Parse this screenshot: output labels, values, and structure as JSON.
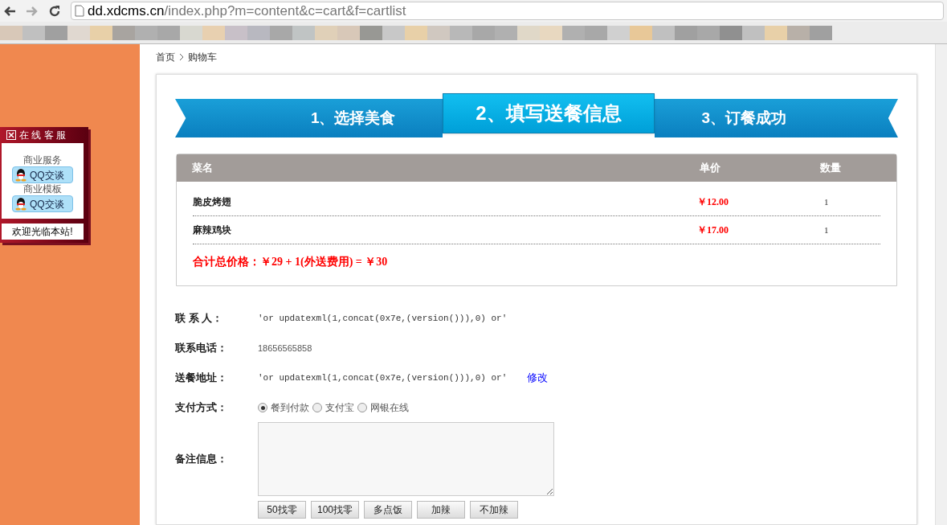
{
  "browser": {
    "url_host": "dd.xdcms.cn",
    "url_path": "/index.php?m=content&c=cart&f=cartlist"
  },
  "service_panel": {
    "title": "在 线 客 服",
    "groups": [
      {
        "label": "商业服务",
        "button": "QQ交谈"
      },
      {
        "label": "商业模板",
        "button": "QQ交谈"
      }
    ],
    "footer": "欢迎光临本站!"
  },
  "breadcrumb": [
    "首页",
    "购物车"
  ],
  "steps": [
    {
      "label": "1、选择美食",
      "selected": false
    },
    {
      "label": "2、填写送餐信息",
      "selected": true
    },
    {
      "label": "3、订餐成功",
      "selected": false
    }
  ],
  "cart": {
    "columns": [
      "菜名",
      "单价",
      "数量"
    ],
    "rows": [
      {
        "name": "脆皮烤翅",
        "price": "￥12.00",
        "qty": "1"
      },
      {
        "name": "麻辣鸡块",
        "price": "￥17.00",
        "qty": "1"
      }
    ],
    "total": "合计总价格：￥29 + 1(外送费用) = ￥30"
  },
  "form": {
    "contact_label": "联 系 人：",
    "contact": "'or updatexml(1,concat(0x7e,(version())),0) or'",
    "phone_label": "联系电话：",
    "phone": "18656565858",
    "address_label": "送餐地址：",
    "address": "'or updatexml(1,concat(0x7e,(version())),0) or'",
    "edit_link": "修改",
    "payment_label": "支付方式：",
    "payment_options": [
      {
        "label": "餐到付款",
        "selected": true
      },
      {
        "label": "支付宝",
        "selected": false
      },
      {
        "label": "网银在线",
        "selected": false
      }
    ],
    "notes_label": "备注信息：",
    "quick_buttons": [
      "50找零",
      "100找零",
      "多点饭",
      "加辣",
      "不加辣"
    ]
  }
}
